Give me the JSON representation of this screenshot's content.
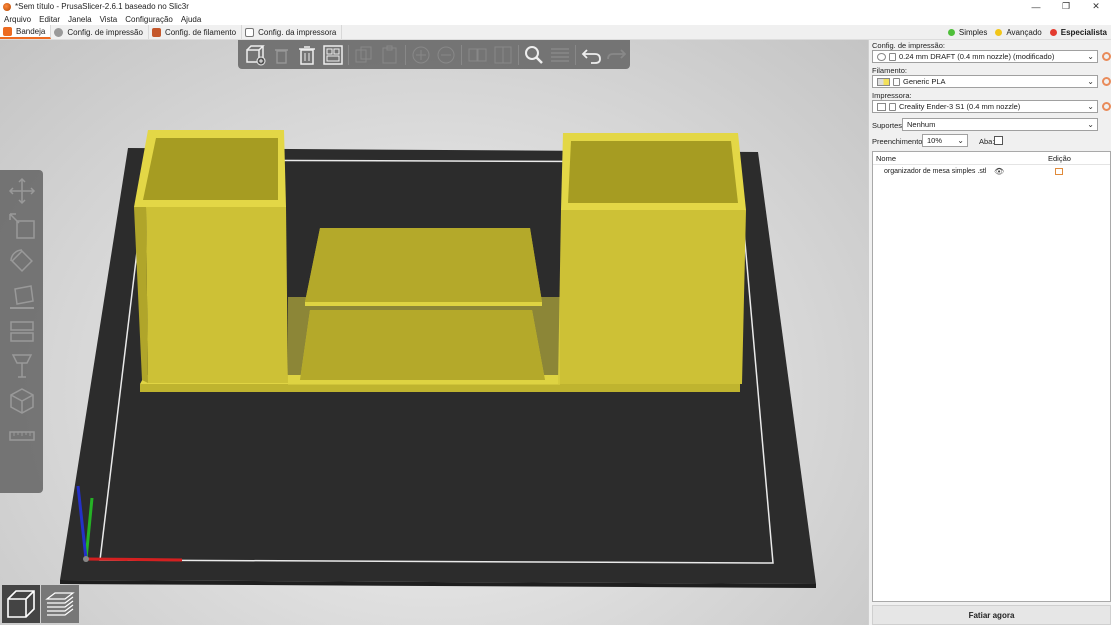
{
  "window": {
    "title": "*Sem título - PrusaSlicer-2.6.1 baseado no Slic3r",
    "minimize": "—",
    "restore": "❐",
    "close": "✕"
  },
  "menu": [
    "Arquivo",
    "Editar",
    "Janela",
    "Vista",
    "Configuração",
    "Ajuda"
  ],
  "tabs": [
    {
      "label": "Bandeja",
      "active": true,
      "icon": "plater-icon"
    },
    {
      "label": "Config. de impressão",
      "active": false,
      "icon": "gear-icon"
    },
    {
      "label": "Config. de filamento",
      "active": false,
      "icon": "spool-icon"
    },
    {
      "label": "Config. da impressora",
      "active": false,
      "icon": "printer-icon"
    }
  ],
  "modes": [
    {
      "label": "Simples",
      "color": "#4fbf3a",
      "active": false
    },
    {
      "label": "Avançado",
      "color": "#f2c619",
      "active": false
    },
    {
      "label": "Especialista",
      "color": "#e33b2f",
      "active": true
    }
  ],
  "panel": {
    "print_label": "Config. de impressão:",
    "print_value": "0.24 mm DRAFT (0.4 mm nozzle) (modificado)",
    "filament_label": "Filamento:",
    "filament_value": "Generic PLA",
    "filament_color": "#f2e05a",
    "printer_label": "Impressora:",
    "printer_value": "Creality Ender-3 S1 (0.4 mm nozzle)",
    "supports_label": "Suportes:",
    "supports_value": "Nenhum",
    "infill_label": "Preenchimento:",
    "infill_value": "10%",
    "brim_label": "Aba:",
    "brim_checked": false,
    "list_header_name": "Nome",
    "list_header_edit": "Edição",
    "objects": [
      {
        "name": "organizador de mesa simples .stl"
      }
    ],
    "slice_button": "Fatiar agora"
  },
  "colors": {
    "accent": "#ed6b21",
    "model": "#d8cc3a",
    "bed": "#2b2b2b"
  }
}
